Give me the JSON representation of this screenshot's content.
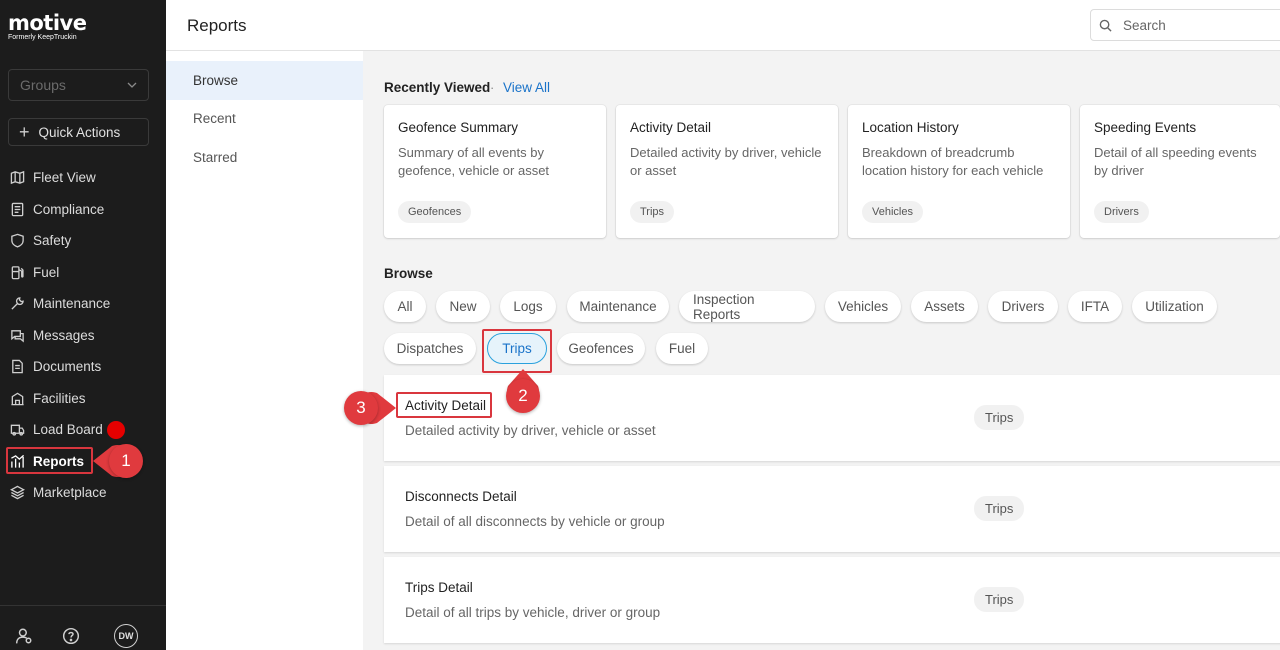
{
  "brand": {
    "name": "motive",
    "subtitle": "Formerly KeepTruckin"
  },
  "sidebar": {
    "groups_label": "Groups",
    "quick_actions_label": "Quick Actions",
    "items": [
      {
        "label": "Fleet View",
        "icon": "map-icon"
      },
      {
        "label": "Compliance",
        "icon": "document-list-icon"
      },
      {
        "label": "Safety",
        "icon": "shield-icon"
      },
      {
        "label": "Fuel",
        "icon": "fuel-pump-icon"
      },
      {
        "label": "Maintenance",
        "icon": "wrench-icon"
      },
      {
        "label": "Messages",
        "icon": "chat-icon"
      },
      {
        "label": "Documents",
        "icon": "file-icon"
      },
      {
        "label": "Facilities",
        "icon": "building-icon"
      },
      {
        "label": "Load Board",
        "icon": "truck-icon"
      },
      {
        "label": "Reports",
        "icon": "chart-icon"
      },
      {
        "label": "Marketplace",
        "icon": "layers-icon"
      }
    ],
    "active_item": "Reports",
    "footer_avatar_initials": "DW"
  },
  "header": {
    "title": "Reports",
    "search_placeholder": "Search"
  },
  "subnav": {
    "items": [
      "Browse",
      "Recent",
      "Starred"
    ],
    "active": "Browse"
  },
  "recently_viewed": {
    "title": "Recently Viewed",
    "separator": "·",
    "view_all": "View All",
    "cards": [
      {
        "title": "Geofence Summary",
        "desc": "Summary of all events by geofence, vehicle or asset",
        "tag": "Geofences"
      },
      {
        "title": "Activity Detail",
        "desc": "Detailed activity by driver, vehicle or asset",
        "tag": "Trips"
      },
      {
        "title": "Location History",
        "desc": "Breakdown of breadcrumb location history for each vehicle",
        "tag": "Vehicles"
      },
      {
        "title": "Speeding Events",
        "desc": "Detail of all speeding events by driver",
        "tag": "Drivers"
      }
    ]
  },
  "browse": {
    "title": "Browse",
    "chips": [
      "All",
      "New",
      "Logs",
      "Maintenance",
      "Inspection Reports",
      "Vehicles",
      "Assets",
      "Drivers",
      "IFTA",
      "Utilization",
      "Dispatches",
      "Trips",
      "Geofences",
      "Fuel"
    ],
    "selected_chip": "Trips",
    "results": [
      {
        "title": "Activity Detail",
        "desc": "Detailed activity by driver, vehicle or asset",
        "tag": "Trips"
      },
      {
        "title": "Disconnects Detail",
        "desc": "Detail of all disconnects by vehicle or group",
        "tag": "Trips"
      },
      {
        "title": "Trips Detail",
        "desc": "Detail of all trips by vehicle, driver or group",
        "tag": "Trips"
      }
    ]
  },
  "annotations": {
    "step1": "1",
    "step2": "2",
    "step3": "3",
    "color": "#e03a3e"
  }
}
